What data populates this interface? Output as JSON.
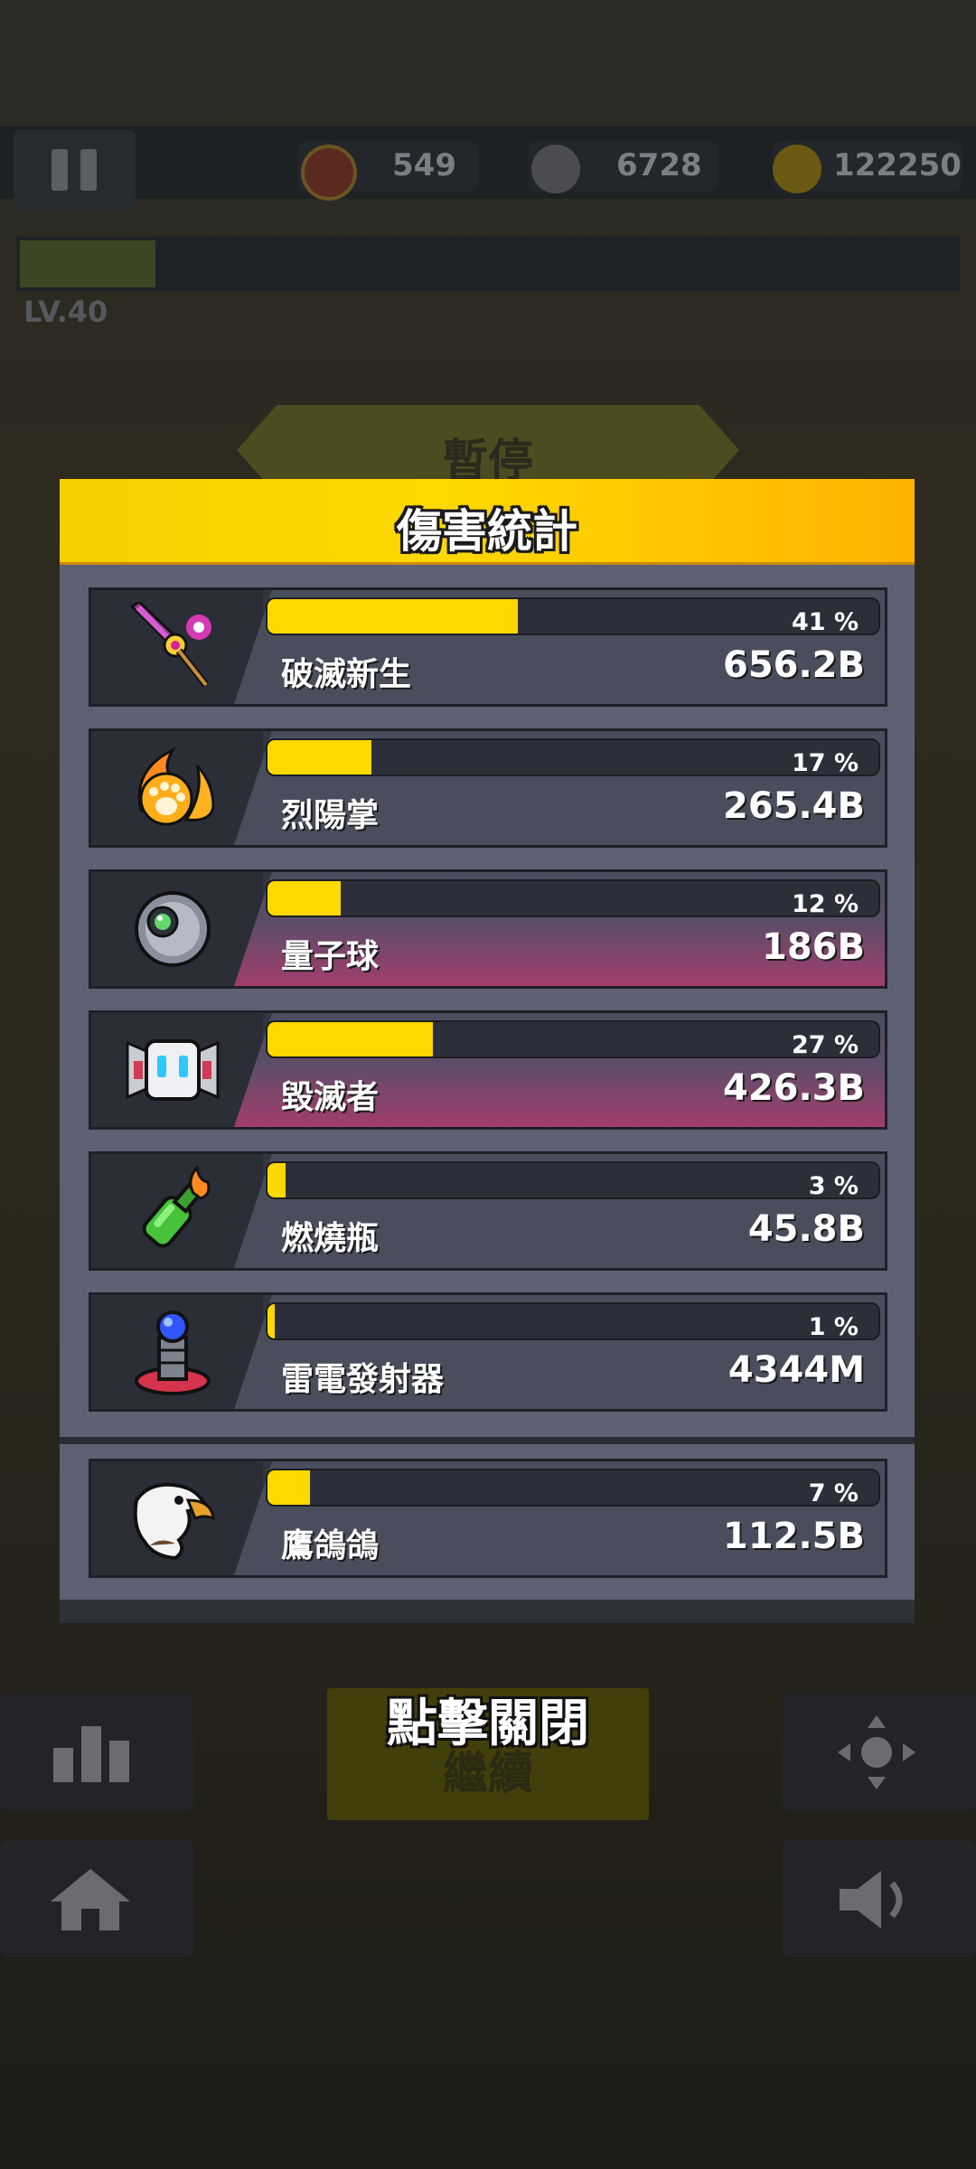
{
  "hud": {
    "hearts": "549",
    "kills": "6728",
    "coins": "122250",
    "level": "LV.40"
  },
  "pause_banner": "暫停",
  "dialog": {
    "title": "傷害統計",
    "weapons": [
      {
        "name": "破滅新生",
        "percent_label": "41 %",
        "percent": 41,
        "damage": "656.2B",
        "icon": "purple-sword-icon",
        "highlight": false
      },
      {
        "name": "烈陽掌",
        "percent_label": "17 %",
        "percent": 17,
        "damage": "265.4B",
        "icon": "flaming-paw-icon",
        "highlight": false
      },
      {
        "name": "量子球",
        "percent_label": "12 %",
        "percent": 12,
        "damage": "186B",
        "icon": "quantum-orb-icon",
        "highlight": true
      },
      {
        "name": "毀滅者",
        "percent_label": "27 %",
        "percent": 27,
        "damage": "426.3B",
        "icon": "robot-drone-icon",
        "highlight": true
      },
      {
        "name": "燃燒瓶",
        "percent_label": "3 %",
        "percent": 3,
        "damage": "45.8B",
        "icon": "molotov-icon",
        "highlight": false
      },
      {
        "name": "雷電發射器",
        "percent_label": "1 %",
        "percent": 1,
        "damage": "4344M",
        "icon": "tesla-coil-icon",
        "highlight": false
      }
    ],
    "companion": {
      "name": "鷹鴿鴿",
      "percent_label": "7 %",
      "percent": 7,
      "damage": "112.5B",
      "icon": "eagle-icon"
    }
  },
  "close_hint": "點擊關閉",
  "continue_label": "繼續",
  "colors": {
    "bar_fill": "#ffd800",
    "header": "#ffd200",
    "panel": "#5d6173"
  }
}
